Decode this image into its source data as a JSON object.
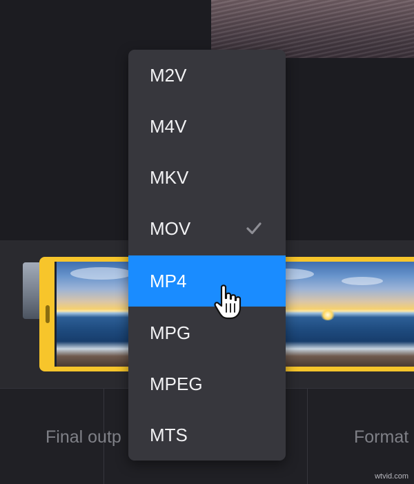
{
  "dropdown": {
    "options": [
      {
        "label": "M2V"
      },
      {
        "label": "M4V"
      },
      {
        "label": "MKV"
      },
      {
        "label": "MOV"
      },
      {
        "label": "MP4"
      },
      {
        "label": "MPG"
      },
      {
        "label": "MPEG"
      },
      {
        "label": "MTS"
      }
    ],
    "checked_option": "MOV",
    "highlighted_option": "MP4"
  },
  "bottom_bar": {
    "left_label": "Final outp",
    "right_label": "Format"
  },
  "watermark": "wtvid.com",
  "icons": {
    "check": "check-icon",
    "cursor": "hand-pointer-icon",
    "trim_handle": "trim-handle-icon"
  },
  "colors": {
    "highlight": "#1a8cff",
    "clip_border": "#f7c52b",
    "menu_bg": "#37373d"
  }
}
